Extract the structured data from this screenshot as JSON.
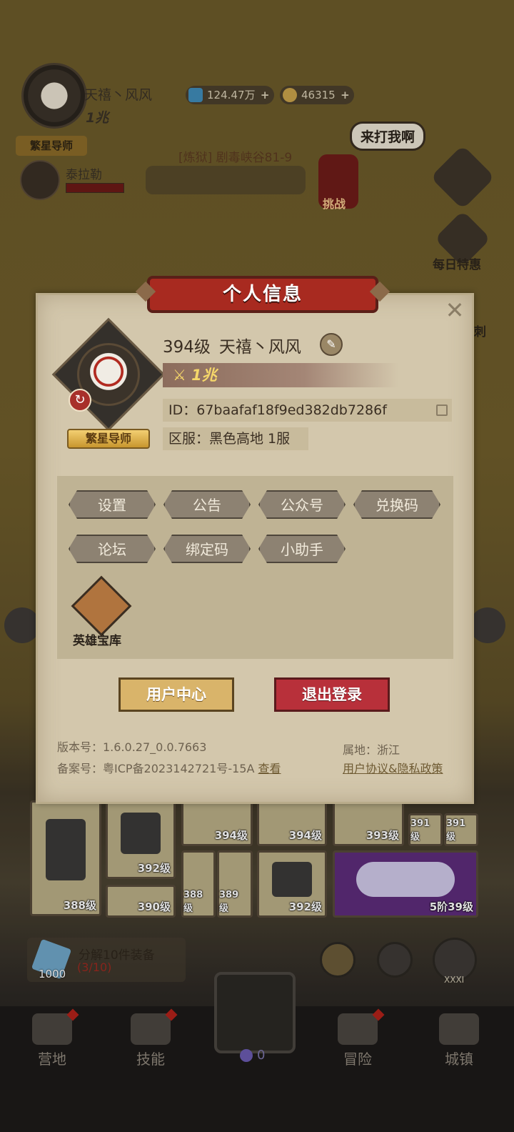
{
  "hud": {
    "player_name": "天禧丶风风",
    "power": "1兆",
    "title_badge": "繁星导师",
    "gems": "124.47万",
    "gold": "46315",
    "ally_name": "泰拉勒",
    "stage": "[炼狱] 剧毒峡谷81-9",
    "speech": "来打我啊",
    "challenge_label": "挑战",
    "daily_deal_label": "每日特惠",
    "side_label_partial": "刺"
  },
  "modal": {
    "title": "个人信息",
    "level": "394级",
    "name": "天禧丶风风",
    "power": "1兆",
    "title_badge": "繁星导师",
    "id_text": "ID：67baafaf18f9ed382db7286f",
    "server_text": "区服：黑色高地 1服",
    "menu": [
      "设置",
      "公告",
      "公众号",
      "兑换码",
      "论坛",
      "绑定码",
      "小助手"
    ],
    "vault_label": "英雄宝库",
    "user_center": "用户中心",
    "logout": "退出登录",
    "version_text": "版本号：1.6.0.27_0.0.7663",
    "icp_text": "备案号：粤ICP备2023142721号-15A",
    "icp_link": "查看",
    "location_text": "属地：浙江",
    "policy_link": "用户协议&隐私政策"
  },
  "inventory": {
    "levels": [
      "388级",
      "392级",
      "394级",
      "394级",
      "393级",
      "391级",
      "391级",
      "390级",
      "388级",
      "389级",
      "392级",
      "5阶39级"
    ],
    "top_partial": "393级",
    "decompose_label": "分解10件装备",
    "decompose_count": "(3/10)",
    "crystal_count": "1000",
    "rank_label": "XXXI"
  },
  "nav": {
    "camp": "营地",
    "skills": "技能",
    "battle_count": "0",
    "adventure": "冒险",
    "town": "城镇"
  },
  "colors": {
    "accent_red": "#a82a20",
    "gold_button": "#d9b46a",
    "logout_red": "#b8303a",
    "power_yellow": "#f5d76a"
  }
}
